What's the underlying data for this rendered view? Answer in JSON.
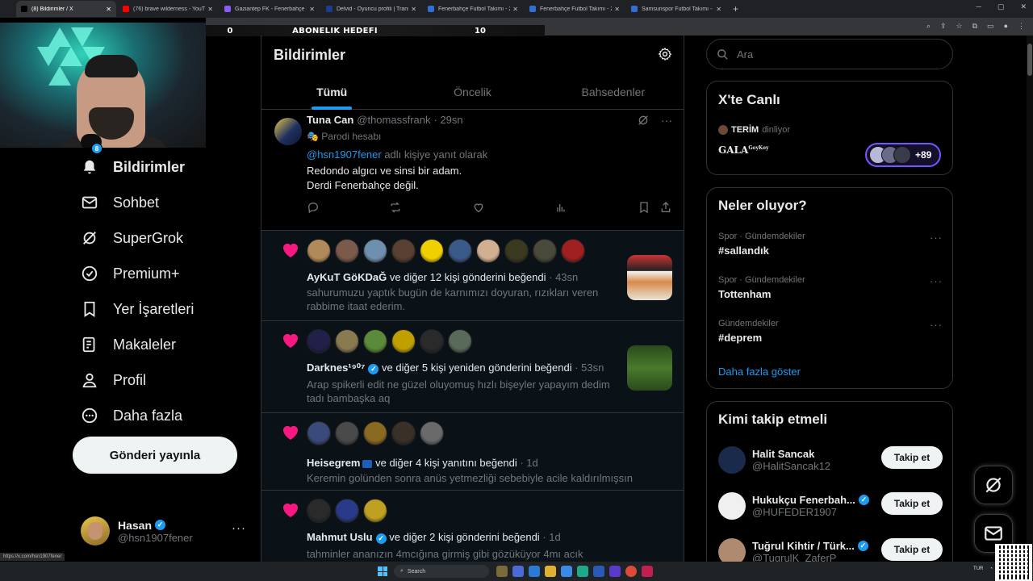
{
  "browser": {
    "tabs": [
      {
        "title": "(8) Bildirimler / X",
        "color": "#000000",
        "active": true
      },
      {
        "title": "(76) brave wilderness - YouTube",
        "color": "#ff0000"
      },
      {
        "title": "Gaziantep FK - Fenerbahçe Maç",
        "color": "#8a5cf6"
      },
      {
        "title": "Delvid - Oyuncu profili | Transfe",
        "color": "#1a3e8c"
      },
      {
        "title": "Fenerbahçe Futbol Takımı - 202",
        "color": "#2f6fd6"
      },
      {
        "title": "Fenerbahçe Futbol Takımı - 202",
        "color": "#2f6fd6"
      },
      {
        "title": "Samsunspor Futbol Takımı - 202",
        "color": "#2f6fd6"
      }
    ],
    "new_tab": "+",
    "status_url": "https://x.com/hsn1907fener"
  },
  "overlay": {
    "left_value": "0",
    "title": "ABONELIK HEDEFI",
    "right_value": "10"
  },
  "nav": {
    "badge": "8",
    "items": [
      {
        "label": "Bildirimler",
        "icon": "bell-icon"
      },
      {
        "label": "Sohbet",
        "icon": "mail-icon"
      },
      {
        "label": "SuperGrok",
        "icon": "grok-icon"
      },
      {
        "label": "Premium+",
        "icon": "verified-icon"
      },
      {
        "label": "Yer İşaretleri",
        "icon": "bookmark-icon"
      },
      {
        "label": "Makaleler",
        "icon": "article-icon"
      },
      {
        "label": "Profil",
        "icon": "profile-icon"
      },
      {
        "label": "Daha fazla",
        "icon": "more-circle-icon"
      }
    ],
    "post_button": "Gönderi yayınla",
    "account": {
      "name": "Hasan",
      "handle": "@hsn1907fener",
      "more": "···"
    }
  },
  "main": {
    "title": "Bildirimler",
    "tabs": [
      "Tümü",
      "Öncelik",
      "Bahsedenler"
    ],
    "reply": {
      "name": "Tuna Can",
      "handle": "@thomassfrank",
      "time": "· 29sn",
      "parody": "Parodi hesabı",
      "mention": "@hsn1907fener",
      "replying_suffix": " adlı kişiye yanıt olarak",
      "line1": "Redondo algıcı ve sinsi bir adam.",
      "line2": "Derdi Fenerbahçe değil."
    },
    "notifications": [
      {
        "user": "AyKuT GöKDaĞ",
        "action": " ve diğer 12 kişi gönderini beğendi",
        "time": " · 43sn",
        "text": "sahurumuzu yaptık bugün de karnımızı doyuran, rızıkları veren rabbime itaat ederim.",
        "avatar_colors": [
          "#b08a5a",
          "#7a5a4a",
          "#6f8fb0",
          "#5a4030",
          "#f0d000",
          "#3a5a8a",
          "#d0b090",
          "#3a3a20",
          "#4a4a3a",
          "#a02020"
        ]
      },
      {
        "user": "Darknes¹⁹⁰⁷",
        "action": " ve diğer 5 kişi yeniden gönderini beğendi",
        "time": " · 53sn",
        "text": "Arap spikerli edit ne güzel oluyomuş hızlı bişeyler yapayım dedim tadı bambaşka aq",
        "avatar_colors": [
          "#20204a",
          "#8a7a50",
          "#5a8a3a",
          "#c0a000",
          "#2a2a2a",
          "#5a6a5a"
        ]
      },
      {
        "user": "Heisegrem",
        "action": " ve diğer 4 kişi yanıtını beğendi",
        "time": " · 1d",
        "text": "Keremin golünden sonra anüs yetmezliği sebebiyle acile kaldırılmışsın",
        "avatar_colors": [
          "#3a4a7a",
          "#4a4a4a",
          "#8a6a20",
          "#3a3028",
          "#6a6a6a"
        ]
      },
      {
        "user": "Mahmut Uslu",
        "action": " ve diğer 2 kişi gönderini beğendi",
        "time": " · 1d",
        "text": "tahminler ananızın 4mcığına girmiş gibi gözüküyor 4mı acık",
        "avatar_colors": [
          "#2a2a2a",
          "#2a3a8a",
          "#c0a020"
        ]
      }
    ]
  },
  "right": {
    "search_placeholder": "Ara",
    "live": {
      "title": "X'te Canlı",
      "listener": "TERİM",
      "listening": "dinliyor",
      "show": "GALA",
      "show_sup": "GoyKoy",
      "count": "+89"
    },
    "trends": {
      "title": "Neler oluyor?",
      "items": [
        {
          "category": "Spor · Gündemdekiler",
          "title": "#sallandık"
        },
        {
          "category": "Spor · Gündemdekiler",
          "title": "Tottenham"
        },
        {
          "category": "Gündemdekiler",
          "title": "#deprem"
        }
      ],
      "more": "Daha fazla göster",
      "dots": "···"
    },
    "who": {
      "title": "Kimi takip etmeli",
      "follow": "Takip et",
      "items": [
        {
          "name": "Halit Sancak",
          "handle": "@HalitSancak12",
          "verified": false,
          "color": "#1a2a4a"
        },
        {
          "name": "Hukukçu Fenerbah...",
          "handle": "@HUFEDER1907",
          "verified": true,
          "color": "#f0f0f0"
        },
        {
          "name": "Tuğrul Kihtir / Türk...",
          "handle": "@TugrulK_ZaferP",
          "verified": true,
          "color": "#b08a70"
        }
      ]
    }
  },
  "taskbar": {
    "search": "Search",
    "lang": "TUR"
  }
}
